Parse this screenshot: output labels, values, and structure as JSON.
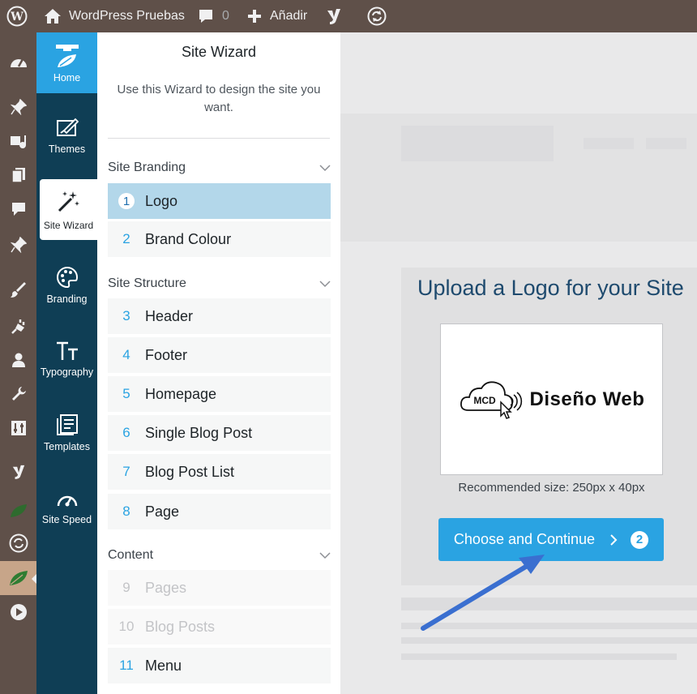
{
  "admin_bar": {
    "site_name": "WordPress Pruebas",
    "comments_count": "0",
    "add_new_label": "Añadir"
  },
  "wizard_nav": {
    "items": [
      {
        "label": "Home",
        "icon": "home-icon"
      },
      {
        "label": "Themes",
        "icon": "themes-icon"
      },
      {
        "label": "Site Wizard",
        "icon": "magic-wand-icon"
      },
      {
        "label": "Branding",
        "icon": "palette-icon"
      },
      {
        "label": "Typography",
        "icon": "typography-icon"
      },
      {
        "label": "Templates",
        "icon": "templates-icon"
      },
      {
        "label": "Site Speed",
        "icon": "speedometer-icon"
      }
    ]
  },
  "panel": {
    "title": "Site Wizard",
    "description": "Use this Wizard to design the site you want.",
    "sections": [
      {
        "title": "Site Branding"
      },
      {
        "title": "Site Structure"
      },
      {
        "title": "Content"
      }
    ],
    "steps": [
      {
        "num": "1",
        "label": "Logo",
        "state": "active"
      },
      {
        "num": "2",
        "label": "Brand Colour",
        "state": "normal"
      },
      {
        "num": "3",
        "label": "Header",
        "state": "normal"
      },
      {
        "num": "4",
        "label": "Footer",
        "state": "normal"
      },
      {
        "num": "5",
        "label": "Homepage",
        "state": "normal"
      },
      {
        "num": "6",
        "label": "Single Blog Post",
        "state": "normal"
      },
      {
        "num": "7",
        "label": "Blog Post List",
        "state": "normal"
      },
      {
        "num": "8",
        "label": "Page",
        "state": "normal"
      },
      {
        "num": "9",
        "label": "Pages",
        "state": "disabled"
      },
      {
        "num": "10",
        "label": "Blog Posts",
        "state": "disabled"
      },
      {
        "num": "11",
        "label": "Menu",
        "state": "normal"
      }
    ]
  },
  "main": {
    "heading": "Upload a Logo for your Site",
    "logo_badge": "MCD",
    "logo_text": "Diseño Web",
    "recommended": "Recommended size: 250px x 40px",
    "cta_label": "Choose and Continue",
    "cta_badge": "2"
  },
  "colors": {
    "admin_bar": "#5f5049",
    "wizard_nav": "#0f3e55",
    "accent": "#2aa3e2",
    "active_step": "#b3d7ea",
    "heading": "#1e4a6e"
  }
}
